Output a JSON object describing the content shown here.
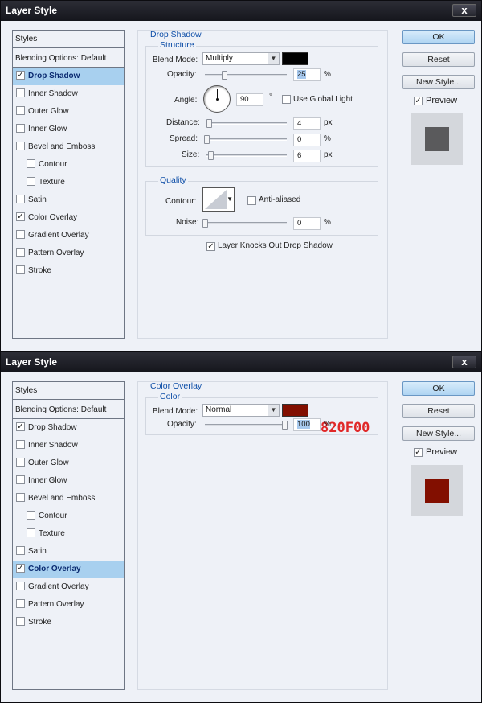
{
  "colors": {
    "shadow_swatch": "#000000",
    "overlay_swatch": "#820F00",
    "shadow_preview": "#5a5a5c",
    "overlay_preview": "#820F00",
    "accent": "#0f4fa8"
  },
  "dialog1": {
    "title": "Layer Style",
    "close": "x",
    "styles_header": "Styles",
    "blending": "Blending Options: Default",
    "items": [
      {
        "label": "Drop Shadow",
        "checked": "✓"
      },
      {
        "label": "Inner Shadow",
        "checked": ""
      },
      {
        "label": "Outer Glow",
        "checked": ""
      },
      {
        "label": "Inner Glow",
        "checked": ""
      },
      {
        "label": "Bevel and Emboss",
        "checked": ""
      },
      {
        "label": "Contour",
        "checked": ""
      },
      {
        "label": "Texture",
        "checked": ""
      },
      {
        "label": "Satin",
        "checked": ""
      },
      {
        "label": "Color Overlay",
        "checked": "✓"
      },
      {
        "label": "Gradient Overlay",
        "checked": ""
      },
      {
        "label": "Pattern Overlay",
        "checked": ""
      },
      {
        "label": "Stroke",
        "checked": ""
      }
    ],
    "panel_title": "Drop Shadow",
    "structure_title": "Structure",
    "blend_mode_label": "Blend Mode:",
    "blend_mode": "Multiply",
    "opacity_label": "Opacity:",
    "opacity": "25",
    "opacity_unit": "%",
    "angle_label": "Angle:",
    "angle": "90",
    "angle_unit": "°",
    "global_light_label": "Use Global Light",
    "distance_label": "Distance:",
    "distance": "4",
    "distance_unit": "px",
    "spread_label": "Spread:",
    "spread": "0",
    "spread_unit": "%",
    "size_label": "Size:",
    "size": "6",
    "size_unit": "px",
    "quality_title": "Quality",
    "contour_label": "Contour:",
    "anti_aliased_label": "Anti-aliased",
    "noise_label": "Noise:",
    "noise": "0",
    "noise_unit": "%",
    "knockout_label": "Layer Knocks Out Drop Shadow",
    "knockout_checked": "✓",
    "ok": "OK",
    "reset": "Reset",
    "new_style": "New Style...",
    "preview_label": "Preview",
    "preview_checked": "✓"
  },
  "dialog2": {
    "title": "Layer Style",
    "close": "x",
    "styles_header": "Styles",
    "blending": "Blending Options: Default",
    "items": [
      {
        "label": "Drop Shadow",
        "checked": "✓"
      },
      {
        "label": "Inner Shadow",
        "checked": ""
      },
      {
        "label": "Outer Glow",
        "checked": ""
      },
      {
        "label": "Inner Glow",
        "checked": ""
      },
      {
        "label": "Bevel and Emboss",
        "checked": ""
      },
      {
        "label": "Contour",
        "checked": ""
      },
      {
        "label": "Texture",
        "checked": ""
      },
      {
        "label": "Satin",
        "checked": ""
      },
      {
        "label": "Color Overlay",
        "checked": "✓"
      },
      {
        "label": "Gradient Overlay",
        "checked": ""
      },
      {
        "label": "Pattern Overlay",
        "checked": ""
      },
      {
        "label": "Stroke",
        "checked": ""
      }
    ],
    "panel_title": "Color Overlay",
    "color_title": "Color",
    "blend_mode_label": "Blend Mode:",
    "blend_mode": "Normal",
    "hex_note": "820F00",
    "opacity_label": "Opacity:",
    "opacity": "100",
    "opacity_unit": "%",
    "ok": "OK",
    "reset": "Reset",
    "new_style": "New Style...",
    "preview_label": "Preview",
    "preview_checked": "✓"
  }
}
